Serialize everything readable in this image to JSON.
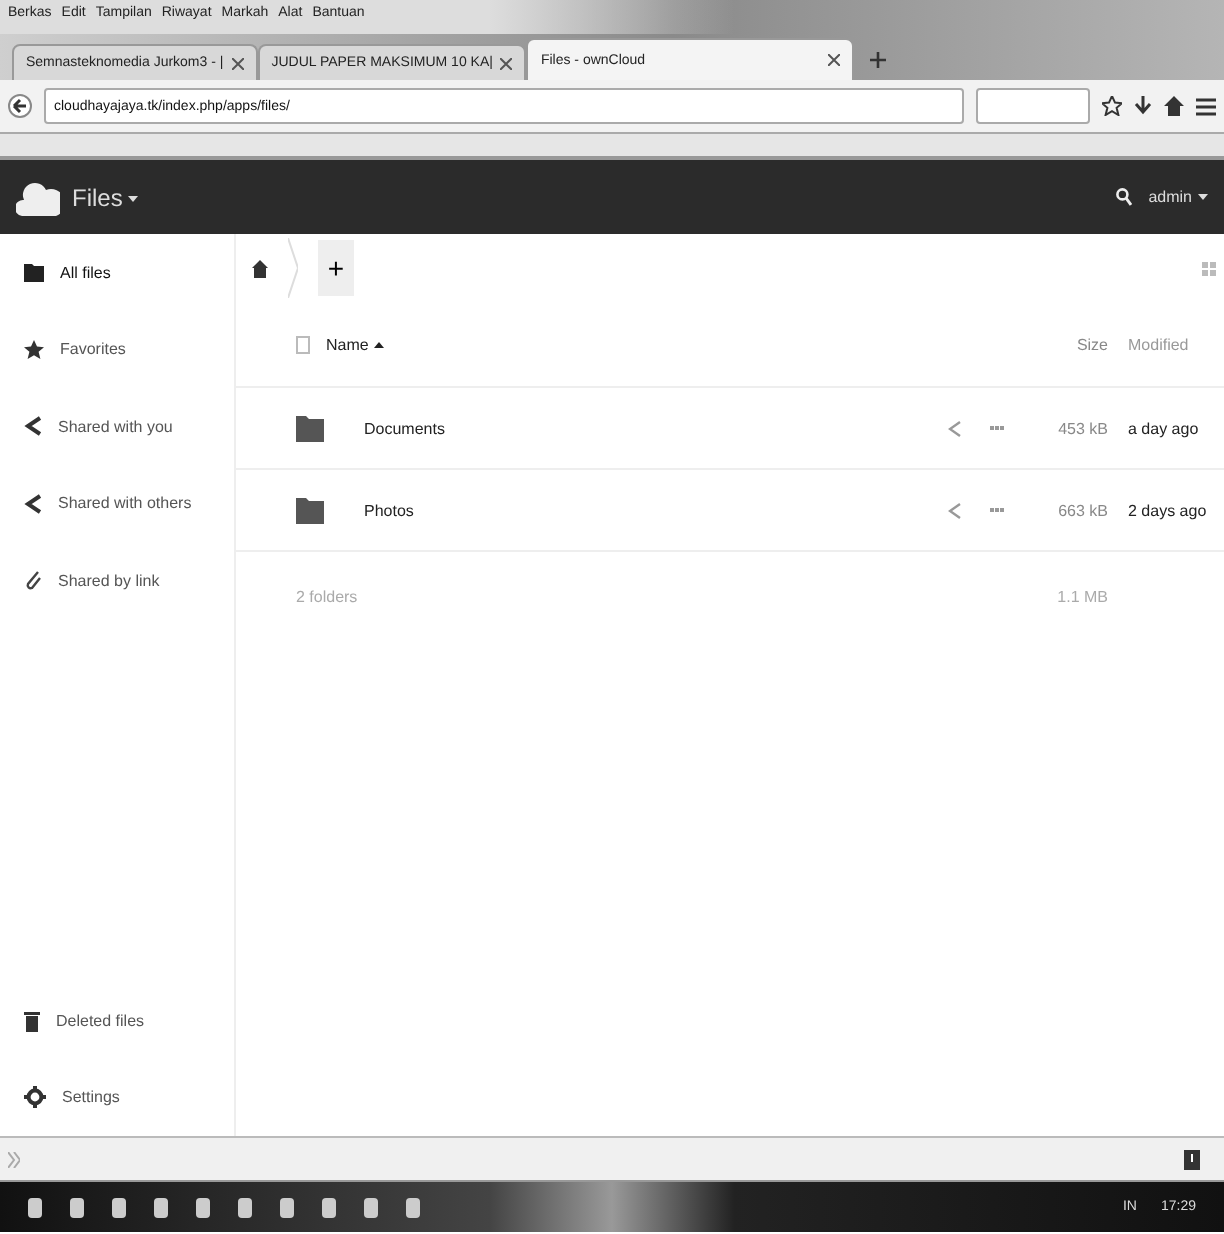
{
  "menu": [
    "Berkas",
    "Edit",
    "Tampilan",
    "Riwayat",
    "Markah",
    "Alat",
    "Bantuan"
  ],
  "tabs": [
    {
      "label": "Semnasteknomedia Jurkom3 - |",
      "selected": false
    },
    {
      "label": "JUDUL PAPER MAKSIMUM 10 KA|",
      "selected": false
    },
    {
      "label": "Files - ownCloud",
      "selected": true
    }
  ],
  "address": {
    "url": "cloudhayajaya.tk/index.php/apps/files/"
  },
  "header": {
    "app": "Files",
    "user": "admin"
  },
  "sidebar": {
    "items": [
      {
        "label": "All files",
        "kind": "folder",
        "selected": true
      },
      {
        "label": "Favorites",
        "kind": "star",
        "selected": false
      },
      {
        "label": "Shared with you",
        "kind": "share",
        "selected": false
      },
      {
        "label": "Shared with others",
        "kind": "share",
        "selected": false
      },
      {
        "label": "Shared by link",
        "kind": "link",
        "selected": false
      }
    ],
    "bottom": [
      {
        "label": "Deleted files",
        "kind": "trash"
      },
      {
        "label": "Settings",
        "kind": "gear"
      }
    ]
  },
  "toolbar": {
    "new": "+"
  },
  "table": {
    "select_all": {
      "checked": false
    },
    "columns": [
      "Name",
      "Size",
      "Modified"
    ],
    "rows": [
      {
        "name": "Documents",
        "size": "453 kB",
        "modified": "a day ago"
      },
      {
        "name": "Photos",
        "size": "663 kB",
        "modified": "2 days ago"
      }
    ],
    "summary": {
      "count": "2 folders",
      "size": "1.1 MB"
    }
  },
  "tray": {
    "language": "IN",
    "time": "17:29"
  }
}
